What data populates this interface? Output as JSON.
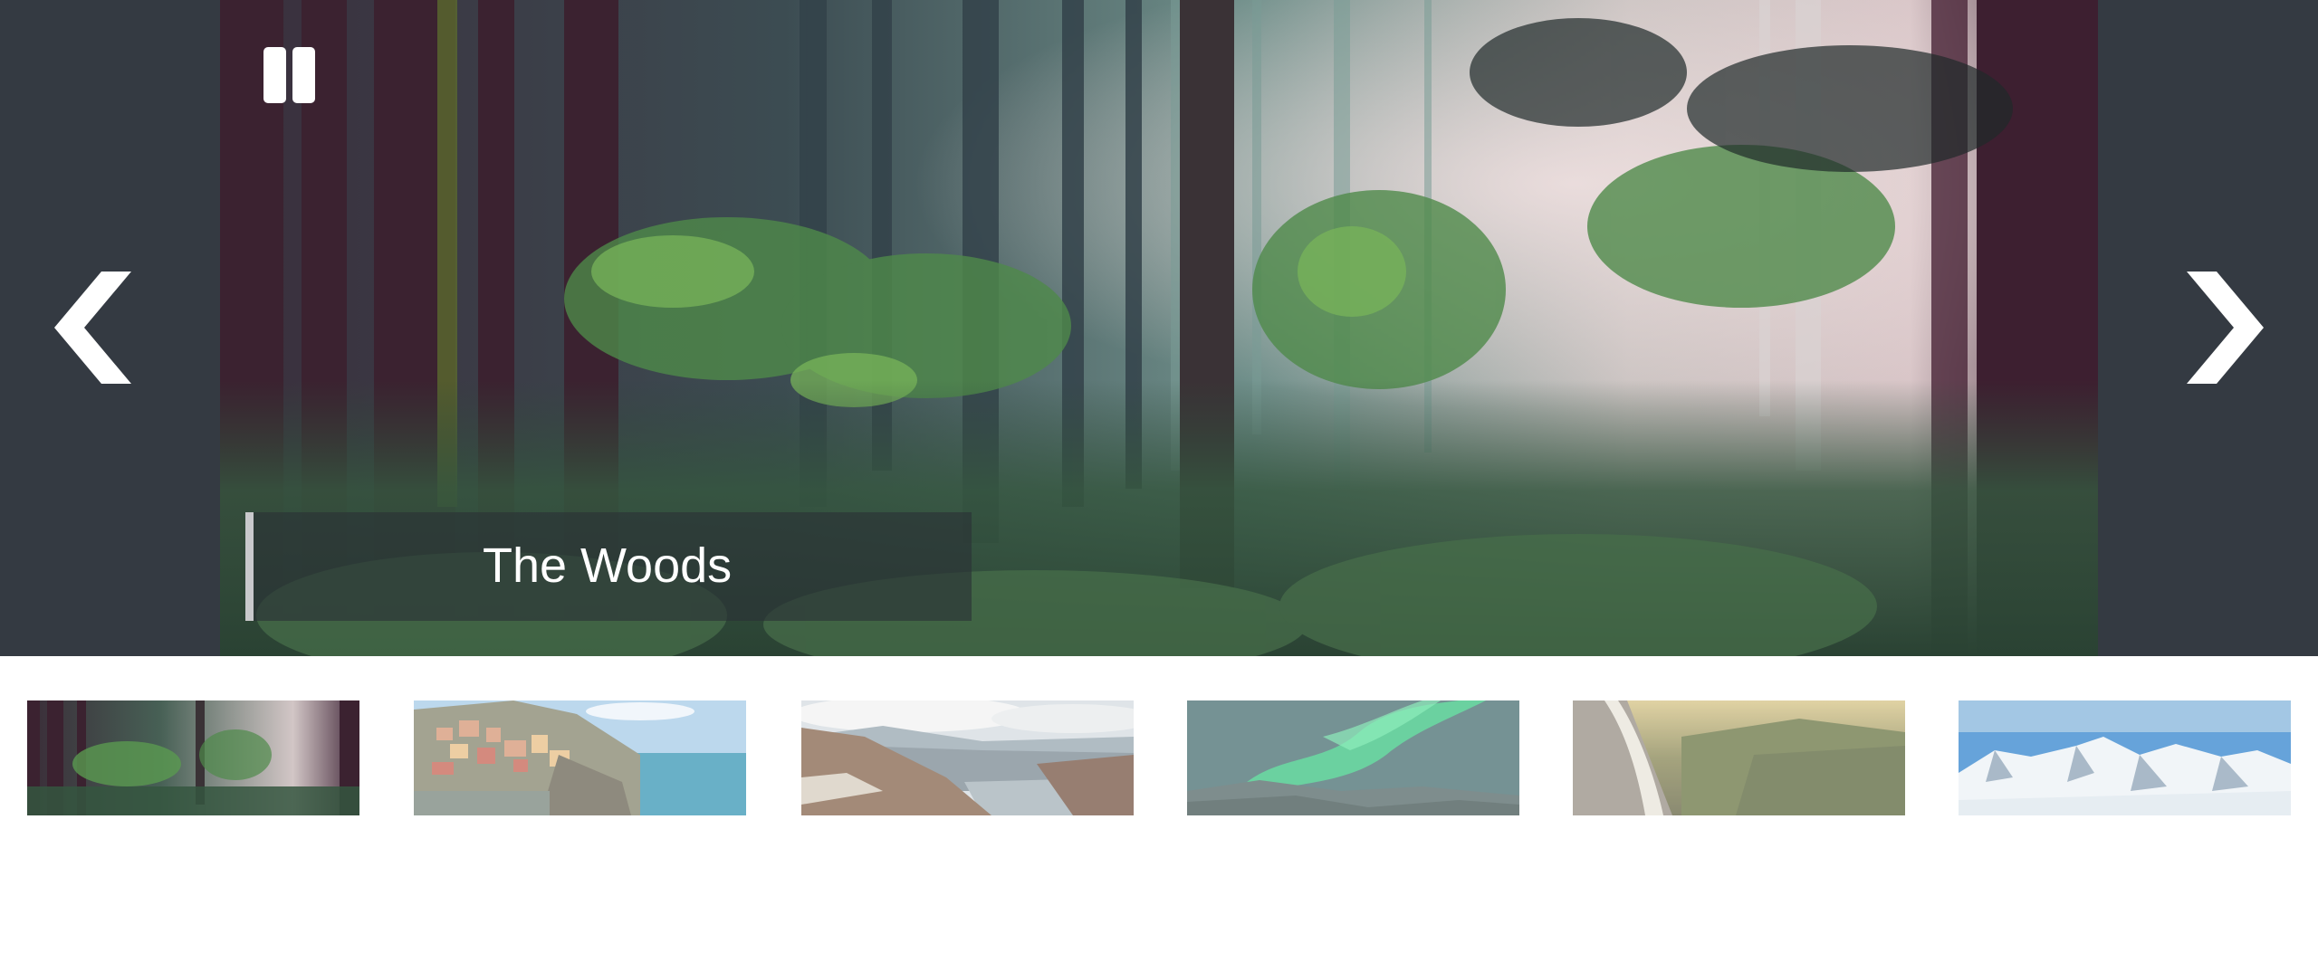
{
  "slideshow": {
    "current_index": 0,
    "caption": "The Woods",
    "controls": {
      "prev_icon": "chevron-left-icon",
      "next_icon": "chevron-right-icon",
      "pause_icon": "pause-icon"
    },
    "colors": {
      "stage_background": "#343a42",
      "caption_background": "#2a3036",
      "caption_accent": "#c9c9cc",
      "control_color": "#ffffff"
    }
  },
  "thumbnails": [
    {
      "subject": "forest",
      "active": true
    },
    {
      "subject": "cliffside-village",
      "active": false
    },
    {
      "subject": "mountain-valley-lake",
      "active": false
    },
    {
      "subject": "aurora",
      "active": false
    },
    {
      "subject": "waterfall-valley",
      "active": false
    },
    {
      "subject": "snowy-mountains",
      "active": false
    }
  ]
}
